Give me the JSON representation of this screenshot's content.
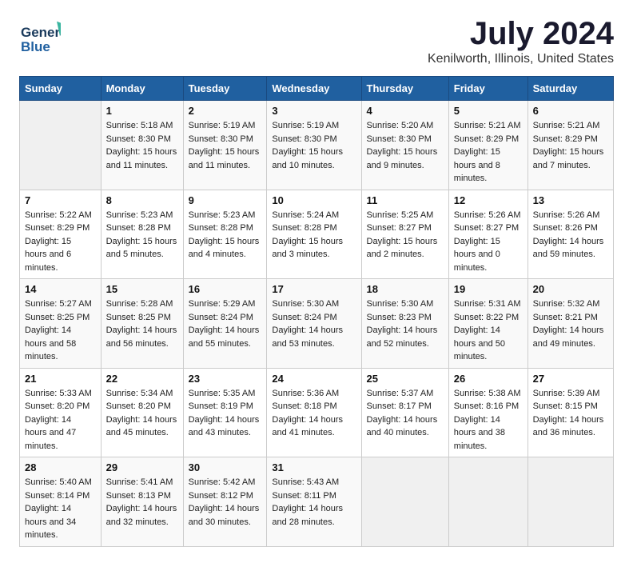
{
  "header": {
    "logo_line1": "General",
    "logo_line2": "Blue",
    "main_title": "July 2024",
    "subtitle": "Kenilworth, Illinois, United States"
  },
  "calendar": {
    "days_of_week": [
      "Sunday",
      "Monday",
      "Tuesday",
      "Wednesday",
      "Thursday",
      "Friday",
      "Saturday"
    ],
    "weeks": [
      [
        {
          "day": "",
          "data": ""
        },
        {
          "day": "1",
          "data": "Sunrise: 5:18 AM\nSunset: 8:30 PM\nDaylight: 15 hours and 11 minutes."
        },
        {
          "day": "2",
          "data": "Sunrise: 5:19 AM\nSunset: 8:30 PM\nDaylight: 15 hours and 11 minutes."
        },
        {
          "day": "3",
          "data": "Sunrise: 5:19 AM\nSunset: 8:30 PM\nDaylight: 15 hours and 10 minutes."
        },
        {
          "day": "4",
          "data": "Sunrise: 5:20 AM\nSunset: 8:30 PM\nDaylight: 15 hours and 9 minutes."
        },
        {
          "day": "5",
          "data": "Sunrise: 5:21 AM\nSunset: 8:29 PM\nDaylight: 15 hours and 8 minutes."
        },
        {
          "day": "6",
          "data": "Sunrise: 5:21 AM\nSunset: 8:29 PM\nDaylight: 15 hours and 7 minutes."
        }
      ],
      [
        {
          "day": "7",
          "data": "Sunrise: 5:22 AM\nSunset: 8:29 PM\nDaylight: 15 hours and 6 minutes."
        },
        {
          "day": "8",
          "data": "Sunrise: 5:23 AM\nSunset: 8:28 PM\nDaylight: 15 hours and 5 minutes."
        },
        {
          "day": "9",
          "data": "Sunrise: 5:23 AM\nSunset: 8:28 PM\nDaylight: 15 hours and 4 minutes."
        },
        {
          "day": "10",
          "data": "Sunrise: 5:24 AM\nSunset: 8:28 PM\nDaylight: 15 hours and 3 minutes."
        },
        {
          "day": "11",
          "data": "Sunrise: 5:25 AM\nSunset: 8:27 PM\nDaylight: 15 hours and 2 minutes."
        },
        {
          "day": "12",
          "data": "Sunrise: 5:26 AM\nSunset: 8:27 PM\nDaylight: 15 hours and 0 minutes."
        },
        {
          "day": "13",
          "data": "Sunrise: 5:26 AM\nSunset: 8:26 PM\nDaylight: 14 hours and 59 minutes."
        }
      ],
      [
        {
          "day": "14",
          "data": "Sunrise: 5:27 AM\nSunset: 8:25 PM\nDaylight: 14 hours and 58 minutes."
        },
        {
          "day": "15",
          "data": "Sunrise: 5:28 AM\nSunset: 8:25 PM\nDaylight: 14 hours and 56 minutes."
        },
        {
          "day": "16",
          "data": "Sunrise: 5:29 AM\nSunset: 8:24 PM\nDaylight: 14 hours and 55 minutes."
        },
        {
          "day": "17",
          "data": "Sunrise: 5:30 AM\nSunset: 8:24 PM\nDaylight: 14 hours and 53 minutes."
        },
        {
          "day": "18",
          "data": "Sunrise: 5:30 AM\nSunset: 8:23 PM\nDaylight: 14 hours and 52 minutes."
        },
        {
          "day": "19",
          "data": "Sunrise: 5:31 AM\nSunset: 8:22 PM\nDaylight: 14 hours and 50 minutes."
        },
        {
          "day": "20",
          "data": "Sunrise: 5:32 AM\nSunset: 8:21 PM\nDaylight: 14 hours and 49 minutes."
        }
      ],
      [
        {
          "day": "21",
          "data": "Sunrise: 5:33 AM\nSunset: 8:20 PM\nDaylight: 14 hours and 47 minutes."
        },
        {
          "day": "22",
          "data": "Sunrise: 5:34 AM\nSunset: 8:20 PM\nDaylight: 14 hours and 45 minutes."
        },
        {
          "day": "23",
          "data": "Sunrise: 5:35 AM\nSunset: 8:19 PM\nDaylight: 14 hours and 43 minutes."
        },
        {
          "day": "24",
          "data": "Sunrise: 5:36 AM\nSunset: 8:18 PM\nDaylight: 14 hours and 41 minutes."
        },
        {
          "day": "25",
          "data": "Sunrise: 5:37 AM\nSunset: 8:17 PM\nDaylight: 14 hours and 40 minutes."
        },
        {
          "day": "26",
          "data": "Sunrise: 5:38 AM\nSunset: 8:16 PM\nDaylight: 14 hours and 38 minutes."
        },
        {
          "day": "27",
          "data": "Sunrise: 5:39 AM\nSunset: 8:15 PM\nDaylight: 14 hours and 36 minutes."
        }
      ],
      [
        {
          "day": "28",
          "data": "Sunrise: 5:40 AM\nSunset: 8:14 PM\nDaylight: 14 hours and 34 minutes."
        },
        {
          "day": "29",
          "data": "Sunrise: 5:41 AM\nSunset: 8:13 PM\nDaylight: 14 hours and 32 minutes."
        },
        {
          "day": "30",
          "data": "Sunrise: 5:42 AM\nSunset: 8:12 PM\nDaylight: 14 hours and 30 minutes."
        },
        {
          "day": "31",
          "data": "Sunrise: 5:43 AM\nSunset: 8:11 PM\nDaylight: 14 hours and 28 minutes."
        },
        {
          "day": "",
          "data": ""
        },
        {
          "day": "",
          "data": ""
        },
        {
          "day": "",
          "data": ""
        }
      ]
    ]
  }
}
